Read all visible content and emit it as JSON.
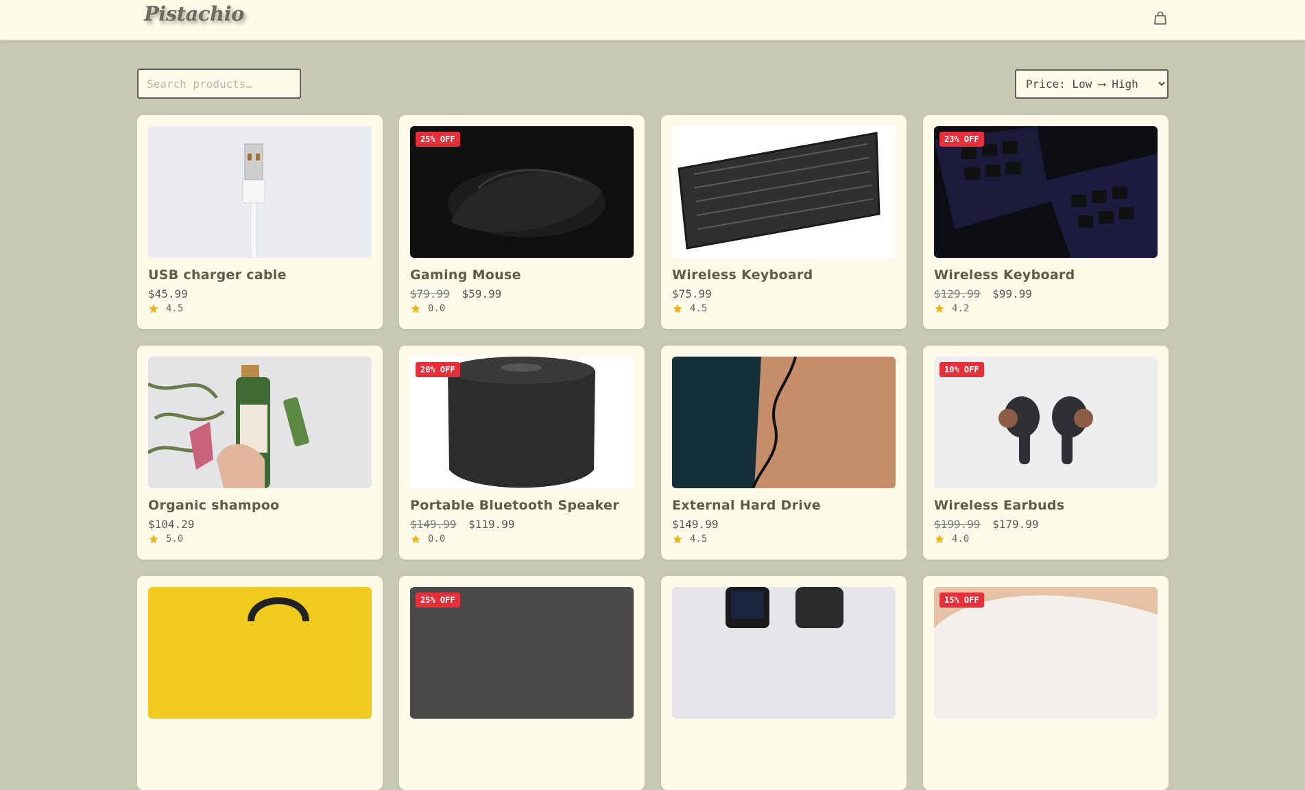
{
  "header": {
    "logo": "Pistachio",
    "cart_icon": "shopping-bag-icon"
  },
  "search": {
    "placeholder": "Search products…",
    "value": ""
  },
  "sort": {
    "selected": "Price: Low ⟶ High",
    "options": [
      "Price: Low ⟶ High"
    ]
  },
  "products": [
    {
      "name": "USB charger cable",
      "old_price": "",
      "price": "$45.99",
      "rating": "4.5",
      "badge": ""
    },
    {
      "name": "Gaming Mouse",
      "old_price": "$79.99",
      "price": "$59.99",
      "rating": "0.0",
      "badge": "25% OFF"
    },
    {
      "name": "Wireless Keyboard",
      "old_price": "",
      "price": "$75.99",
      "rating": "4.5",
      "badge": ""
    },
    {
      "name": "Wireless Keyboard",
      "old_price": "$129.99",
      "price": "$99.99",
      "rating": "4.2",
      "badge": "23% OFF"
    },
    {
      "name": "Organic shampoo",
      "old_price": "",
      "price": "$104.29",
      "rating": "5.0",
      "badge": ""
    },
    {
      "name": "Portable Bluetooth Speaker",
      "old_price": "$149.99",
      "price": "$119.99",
      "rating": "0.0",
      "badge": "20% OFF"
    },
    {
      "name": "External Hard Drive",
      "old_price": "",
      "price": "$149.99",
      "rating": "4.5",
      "badge": ""
    },
    {
      "name": "Wireless Earbuds",
      "old_price": "$199.99",
      "price": "$179.99",
      "rating": "4.0",
      "badge": "10% OFF"
    },
    {
      "name": "",
      "old_price": "",
      "price": "",
      "rating": "",
      "badge": ""
    },
    {
      "name": "",
      "old_price": "",
      "price": "",
      "rating": "",
      "badge": "25% OFF"
    },
    {
      "name": "",
      "old_price": "",
      "price": "",
      "rating": "",
      "badge": ""
    },
    {
      "name": "",
      "old_price": "",
      "price": "",
      "rating": "",
      "badge": "15% OFF"
    }
  ],
  "colors": {
    "background": "#c8c9b2",
    "card": "#fdfcea",
    "badge": "#e5303c",
    "star": "#f0b323"
  }
}
